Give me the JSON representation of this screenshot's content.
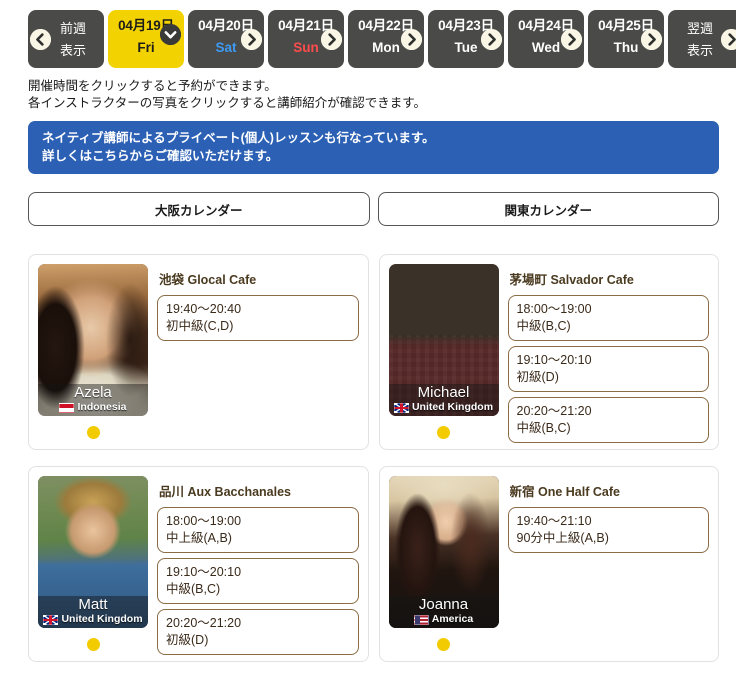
{
  "nav": {
    "prev_line1": "前週",
    "prev_line2": "表示",
    "next_line1": "翌週",
    "next_line2": "表示"
  },
  "tabs": [
    {
      "date": "04月19日",
      "dow": "Fri",
      "dow_type": "weekday",
      "active": true,
      "badge": "chevron-down"
    },
    {
      "date": "04月20日",
      "dow": "Sat",
      "dow_type": "sat",
      "active": false,
      "badge": "chevron-right"
    },
    {
      "date": "04月21日",
      "dow": "Sun",
      "dow_type": "sun",
      "active": false,
      "badge": "chevron-right"
    },
    {
      "date": "04月22日",
      "dow": "Mon",
      "dow_type": "weekday",
      "active": false,
      "badge": "chevron-right"
    },
    {
      "date": "04月23日",
      "dow": "Tue",
      "dow_type": "weekday",
      "active": false,
      "badge": "chevron-right"
    },
    {
      "date": "04月24日",
      "dow": "Wed",
      "dow_type": "weekday",
      "active": false,
      "badge": "chevron-right"
    },
    {
      "date": "04月25日",
      "dow": "Thu",
      "dow_type": "weekday",
      "active": false,
      "badge": "chevron-right"
    }
  ],
  "info": {
    "line1": "開催時間をクリックすると予約ができます。",
    "line2": "各インストラクターの写真をクリックすると講師紹介が確認できます。"
  },
  "notice": {
    "line1": "ネイティブ講師によるプライベート(個人)レッスンも行なっています。",
    "line2": "詳しくはこちらからご確認いただけます。",
    "background": "#2b60b5"
  },
  "calendar_buttons": [
    {
      "label": "大阪カレンダー"
    },
    {
      "label": "関東カレンダー"
    }
  ],
  "colors": {
    "tab_bg": "#4a4a48",
    "tab_active_bg": "#f2d200",
    "saturday": "#3d9bf5",
    "sunday": "#ff4d4d",
    "slot_border": "#8a6c45",
    "dot": "#f2cc00"
  },
  "cards": [
    {
      "instructor": "Azela",
      "country": "Indonesia",
      "flag": "indonesia",
      "venue": "池袋 Glocal Cafe",
      "slots": [
        {
          "time": "19:40〜20:40",
          "level": "初中級(C,D)"
        }
      ]
    },
    {
      "instructor": "Michael",
      "country": "United Kingdom",
      "flag": "united-kingdom",
      "venue": "茅場町 Salvador Cafe",
      "slots": [
        {
          "time": "18:00〜19:00",
          "level": "中級(B,C)"
        },
        {
          "time": "19:10〜20:10",
          "level": "初級(D)"
        },
        {
          "time": "20:20〜21:20",
          "level": "中級(B,C)"
        }
      ]
    },
    {
      "instructor": "Matt",
      "country": "United Kingdom",
      "flag": "united-kingdom",
      "venue": "品川 Aux Bacchanales",
      "slots": [
        {
          "time": "18:00〜19:00",
          "level": "中上級(A,B)"
        },
        {
          "time": "19:10〜20:10",
          "level": "中級(B,C)"
        },
        {
          "time": "20:20〜21:20",
          "level": "初級(D)"
        }
      ]
    },
    {
      "instructor": "Joanna",
      "country": "America",
      "flag": "america",
      "venue": "新宿 One Half Cafe",
      "slots": [
        {
          "time": "19:40〜21:10",
          "level": "90分中上級(A,B)"
        }
      ]
    }
  ]
}
